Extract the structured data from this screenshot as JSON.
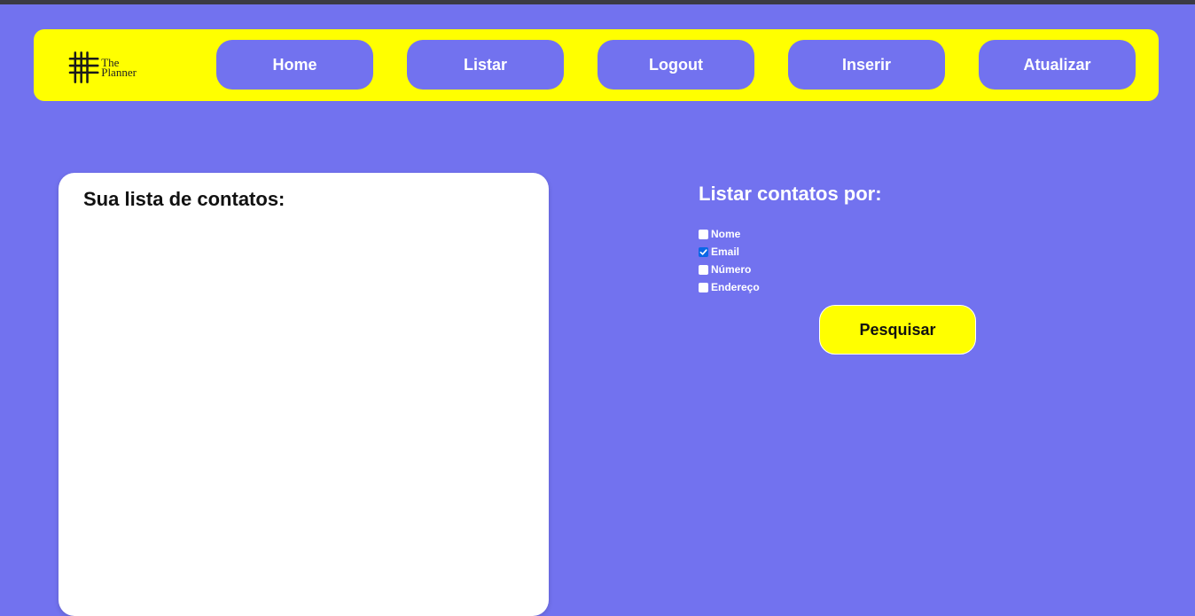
{
  "colors": {
    "background": "#7272ef",
    "navbar": "#ffff00",
    "accent": "#ffff00",
    "card": "#ffffff"
  },
  "logo": {
    "icon": "hash-grid-icon",
    "line1": "The",
    "line2": "Planner"
  },
  "nav": {
    "items": [
      {
        "label": "Home"
      },
      {
        "label": "Listar"
      },
      {
        "label": "Logout"
      },
      {
        "label": "Inserir"
      },
      {
        "label": "Atualizar"
      }
    ]
  },
  "contacts_card": {
    "title": "Sua lista de contatos:"
  },
  "filter": {
    "title": "Listar contatos por:",
    "options": [
      {
        "label": "Nome",
        "checked": false
      },
      {
        "label": "Email",
        "checked": true
      },
      {
        "label": "Número",
        "checked": false
      },
      {
        "label": "Endereço",
        "checked": false
      }
    ],
    "search_label": "Pesquisar"
  }
}
